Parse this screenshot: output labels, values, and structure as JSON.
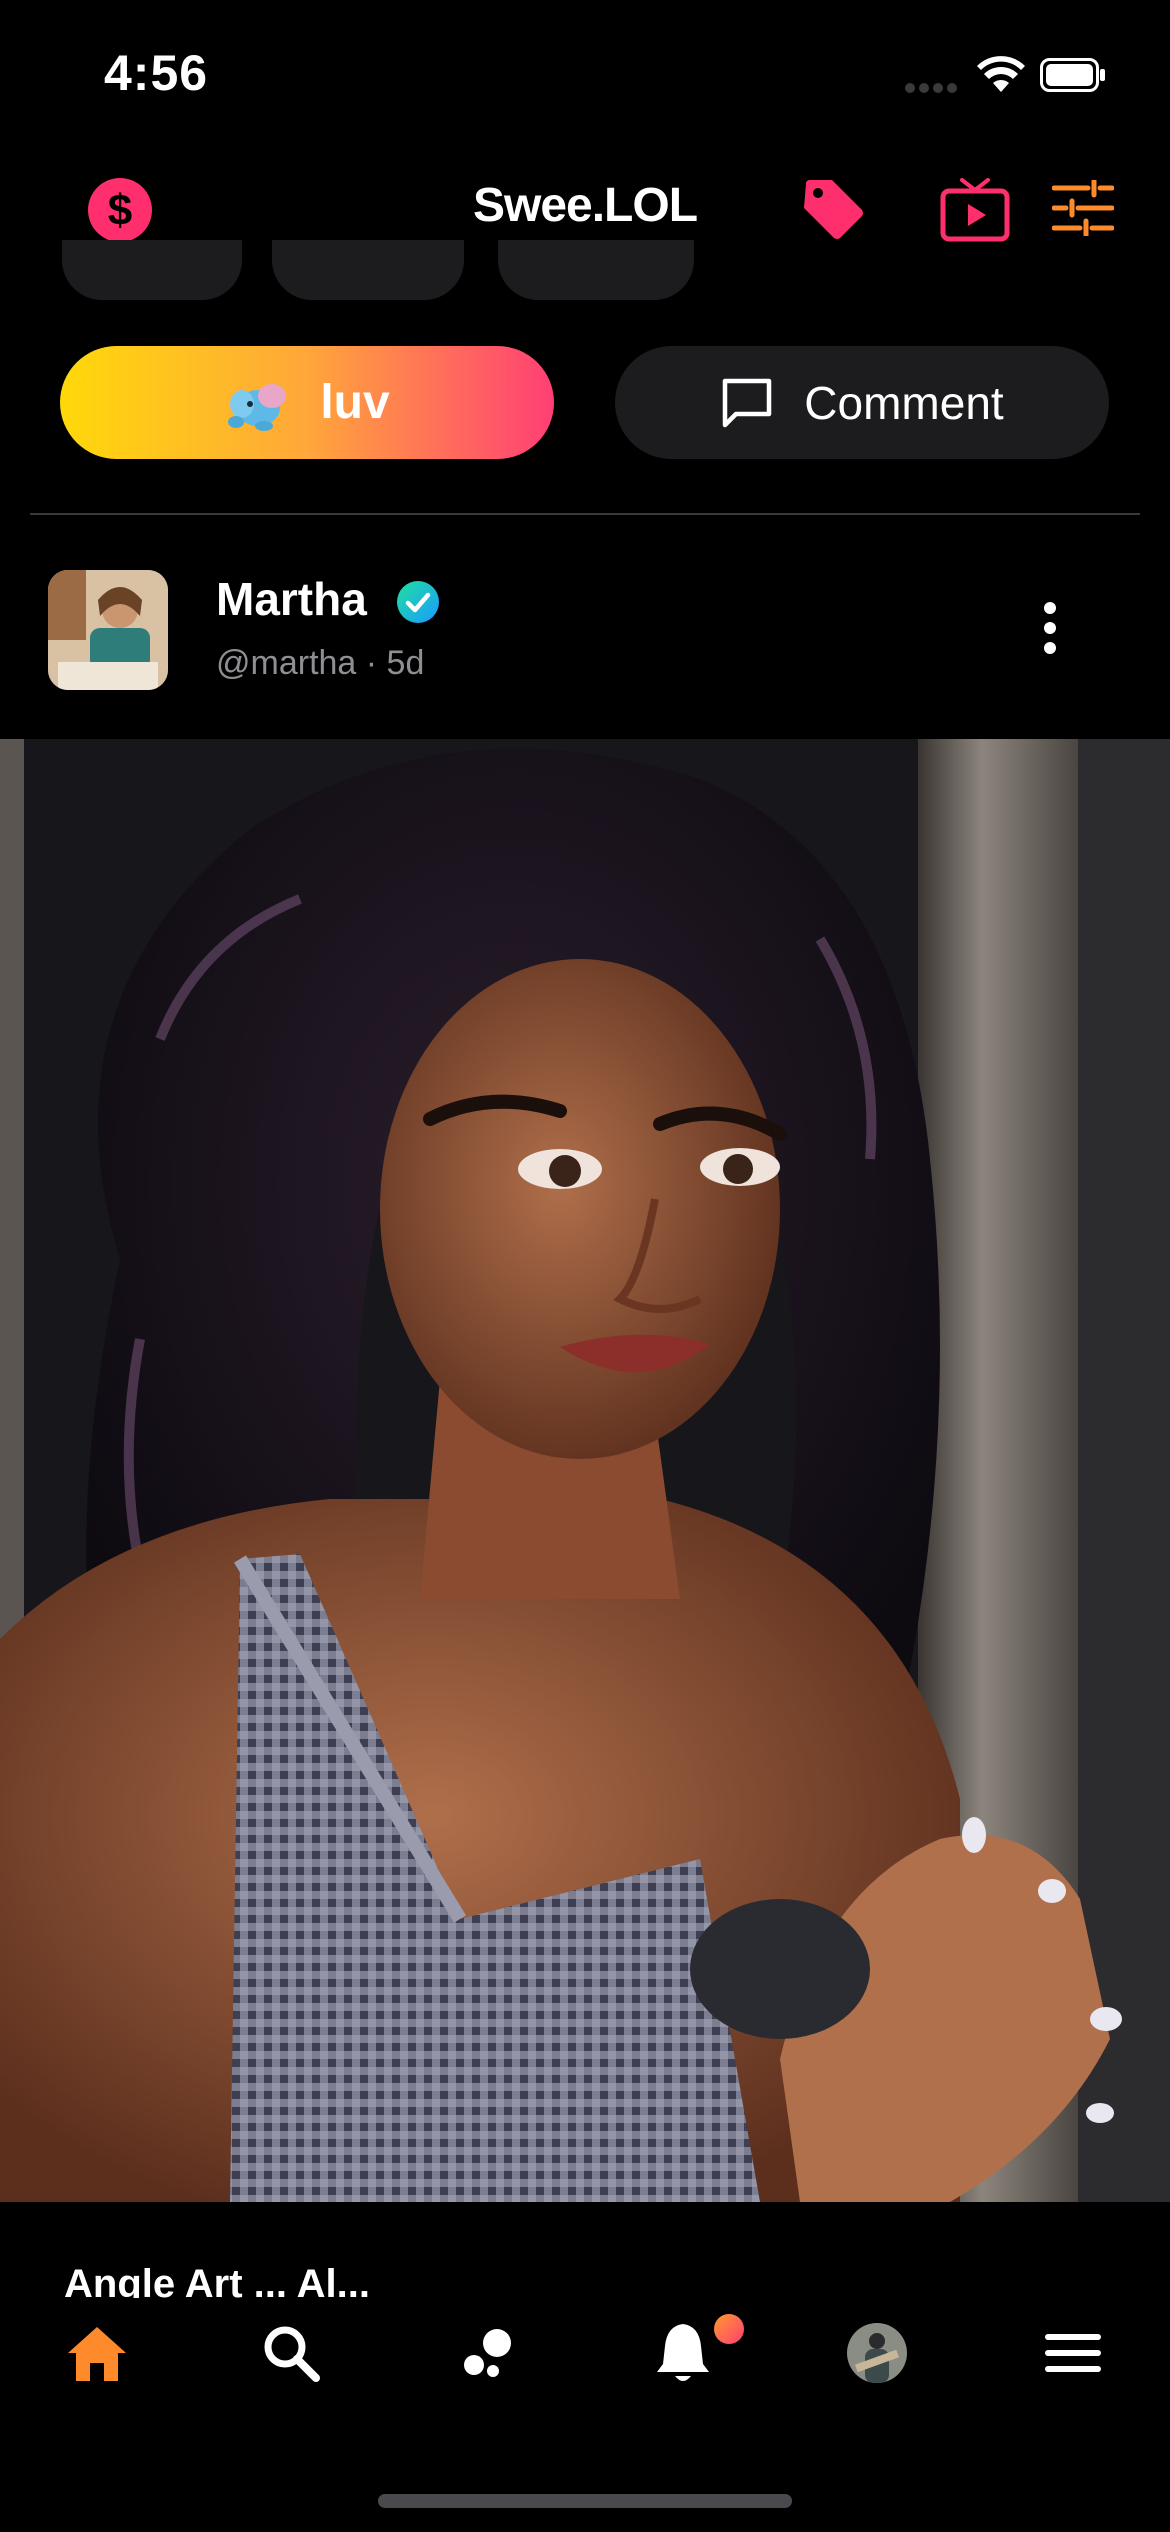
{
  "status_bar": {
    "time": "4:56"
  },
  "header": {
    "title": "Swee.LOL"
  },
  "actions": {
    "luv_label": "luv",
    "comment_label": "Comment"
  },
  "post": {
    "author_name": "Martha",
    "handle_line": "@martha · 5d",
    "caption_partial": "Angle Art ... Al..."
  },
  "tabs": [
    "home",
    "search",
    "discover",
    "notifications",
    "profile",
    "menu"
  ],
  "colors": {
    "accent_pink": "#FF2F6D",
    "accent_orange": "#FF8A2B",
    "luv_gradient_start": "#FFD90A",
    "luv_gradient_end": "#FF3F75",
    "verified": "#1FC7B6",
    "notification_dot": "#FF6A3D"
  }
}
